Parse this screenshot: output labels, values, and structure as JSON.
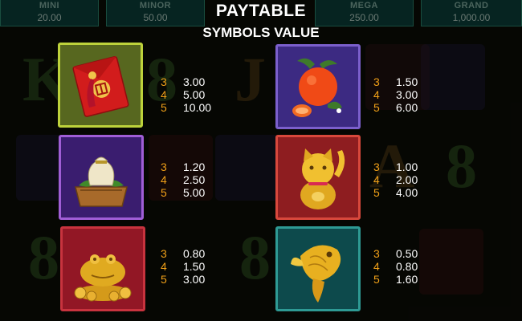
{
  "jackpots": [
    {
      "name": "MINI",
      "value": "20.00"
    },
    {
      "name": "MINOR",
      "value": "50.00"
    },
    {
      "name": "MEGA",
      "value": "250.00"
    },
    {
      "name": "GRAND",
      "value": "1,000.00"
    }
  ],
  "header": {
    "title": "PAYTABLE",
    "subtitle": "SYMBOLS VALUE"
  },
  "symbols": [
    {
      "name": "red envelope",
      "icon": "red-envelope-icon",
      "pays": [
        {
          "count": "3",
          "value": "3.00"
        },
        {
          "count": "4",
          "value": "5.00"
        },
        {
          "count": "5",
          "value": "10.00"
        }
      ]
    },
    {
      "name": "mandarin",
      "icon": "mandarin-orange-icon",
      "pays": [
        {
          "count": "3",
          "value": "1.50"
        },
        {
          "count": "4",
          "value": "3.00"
        },
        {
          "count": "5",
          "value": "6.00"
        }
      ]
    },
    {
      "name": "money bag",
      "icon": "money-bag-icon",
      "pays": [
        {
          "count": "3",
          "value": "1.20"
        },
        {
          "count": "4",
          "value": "2.50"
        },
        {
          "count": "5",
          "value": "5.00"
        }
      ]
    },
    {
      "name": "lucky cat",
      "icon": "lucky-cat-icon",
      "pays": [
        {
          "count": "3",
          "value": "1.00"
        },
        {
          "count": "4",
          "value": "2.00"
        },
        {
          "count": "5",
          "value": "4.00"
        }
      ]
    },
    {
      "name": "money toad",
      "icon": "money-toad-icon",
      "pays": [
        {
          "count": "3",
          "value": "0.80"
        },
        {
          "count": "4",
          "value": "1.50"
        },
        {
          "count": "5",
          "value": "3.00"
        }
      ]
    },
    {
      "name": "golden fish",
      "icon": "golden-fish-icon",
      "pays": [
        {
          "count": "3",
          "value": "0.50"
        },
        {
          "count": "4",
          "value": "0.80"
        },
        {
          "count": "5",
          "value": "1.60"
        }
      ]
    }
  ],
  "colors": {
    "background": "#0c0d07",
    "count_orange": "#f0a018",
    "value_white": "#ffffff"
  }
}
